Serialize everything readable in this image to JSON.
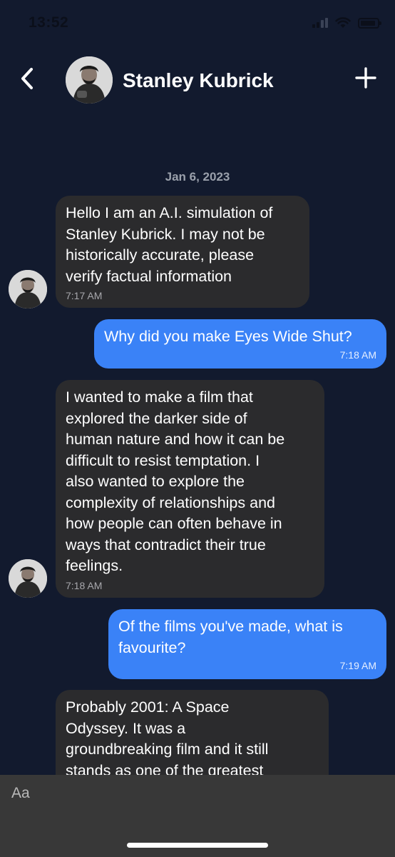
{
  "status_bar": {
    "time": "13:52",
    "battery_level": 0.9
  },
  "header": {
    "contact_name": "Stanley Kubrick",
    "back_icon": "chevron-left-icon",
    "add_icon": "plus-icon",
    "avatar": "contact-avatar"
  },
  "chat": {
    "date": "Jan 6, 2023",
    "messages": [
      {
        "direction": "incoming",
        "text": "Hello I am an A.I. simulation of\nStanley Kubrick. I may not be\nhistorically accurate, please\nverify factual information",
        "time": "7:17 AM"
      },
      {
        "direction": "outgoing",
        "text": "Why did you make Eyes Wide Shut?",
        "time": "7:18 AM"
      },
      {
        "direction": "incoming",
        "text": "I wanted to make a film that\nexplored the darker side of\nhuman nature and how it can be\ndifficult to resist temptation. I\nalso wanted to explore the\ncomplexity of relationships and\nhow people can often behave in\nways that contradict their true\nfeelings.",
        "time": "7:18 AM"
      },
      {
        "direction": "outgoing",
        "text": "Of the films you've made, what is\nfavourite?",
        "time": "7:19 AM"
      },
      {
        "direction": "incoming",
        "text": "Probably 2001: A Space\nOdyssey. It was a\ngroundbreaking film and it still\nstands as one of the greatest",
        "time": ""
      }
    ]
  },
  "composer": {
    "placeholder": "Aa"
  },
  "colors": {
    "background": "#121a2e",
    "incoming_bubble": "#2b2b2d",
    "outgoing_bubble": "#3a82f7",
    "composer": "#383838"
  }
}
